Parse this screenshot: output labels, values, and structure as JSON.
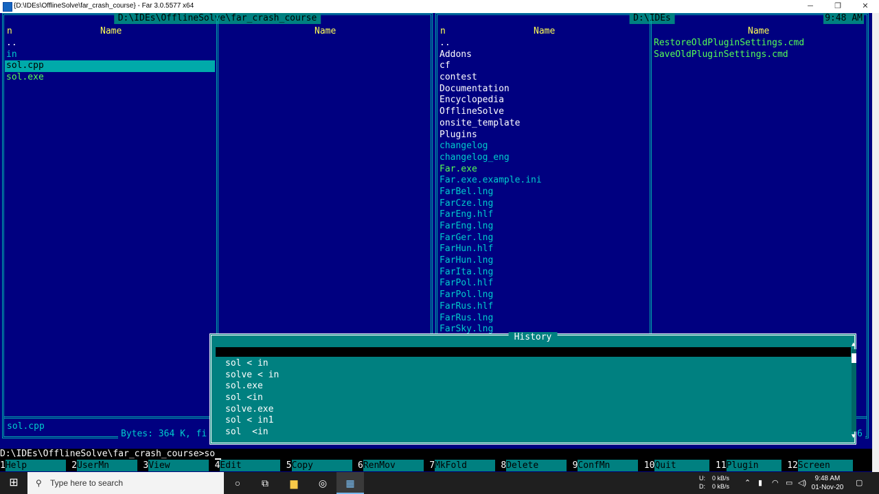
{
  "window": {
    "title": "{D:\\IDEs\\OfflineSolve\\far_crash_course} - Far 3.0.5577 x64",
    "min": "─",
    "restore": "❐",
    "close": "✕"
  },
  "left_panel": {
    "path": "D:\\IDEs\\OfflineSolve\\far_crash_course",
    "col1_header_n": "n",
    "col1_header": "Name",
    "col2_header": "Name",
    "items": [
      {
        "name": "..",
        "kind": "dir"
      },
      {
        "name": "in",
        "kind": "file"
      },
      {
        "name": "sol.cpp",
        "kind": "file",
        "selected": true
      },
      {
        "name": "sol.exe",
        "kind": "exe"
      }
    ],
    "status_name": "sol.cpp",
    "info": "Bytes: 364 K, fi"
  },
  "right_panel": {
    "path": "D:\\IDEs",
    "clock": "9:48 AM",
    "col1_header_n": "n",
    "col1_header": "Name",
    "col2_header": "Name",
    "items_col1": [
      {
        "name": "..",
        "kind": "dir"
      },
      {
        "name": "Addons",
        "kind": "dir"
      },
      {
        "name": "cf",
        "kind": "dir"
      },
      {
        "name": "contest",
        "kind": "dir"
      },
      {
        "name": "Documentation",
        "kind": "dir"
      },
      {
        "name": "Encyclopedia",
        "kind": "dir"
      },
      {
        "name": "OfflineSolve",
        "kind": "dir"
      },
      {
        "name": "onsite_template",
        "kind": "dir"
      },
      {
        "name": "Plugins",
        "kind": "dir"
      },
      {
        "name": "changelog",
        "kind": "file"
      },
      {
        "name": "changelog_eng",
        "kind": "file"
      },
      {
        "name": "Far.exe",
        "kind": "exe"
      },
      {
        "name": "Far.exe.example.ini",
        "kind": "file"
      },
      {
        "name": "FarBel.lng",
        "kind": "file"
      },
      {
        "name": "FarCze.lng",
        "kind": "file"
      },
      {
        "name": "FarEng.hlf",
        "kind": "file"
      },
      {
        "name": "FarEng.lng",
        "kind": "file"
      },
      {
        "name": "FarGer.lng",
        "kind": "file"
      },
      {
        "name": "FarHun.hlf",
        "kind": "file"
      },
      {
        "name": "FarHun.lng",
        "kind": "file"
      },
      {
        "name": "FarIta.lng",
        "kind": "file"
      },
      {
        "name": "FarPol.hlf",
        "kind": "file"
      },
      {
        "name": "FarPol.lng",
        "kind": "file"
      },
      {
        "name": "FarRus.hlf",
        "kind": "file"
      },
      {
        "name": "FarRus.lng",
        "kind": "file"
      },
      {
        "name": "FarSky.lng",
        "kind": "file"
      }
    ],
    "items_col2": [
      {
        "name": "RestoreOldPluginSettings.cmd",
        "kind": "cmd"
      },
      {
        "name": "SaveOldPluginSettings.cmd",
        "kind": "cmd"
      }
    ],
    "info_right": "6"
  },
  "history": {
    "title": "History",
    "items": [
      "sol < in",
      "solve < in",
      "sol.exe",
      "sol <in",
      "solve.exe",
      "sol < in1",
      "sol  <in"
    ],
    "scroll_up": "▲",
    "scroll_down": "▼"
  },
  "cmdline": {
    "prompt": "D:\\IDEs\\OfflineSolve\\far_crash_course>",
    "text": "so"
  },
  "keybar": [
    {
      "num": "1",
      "label": "Help"
    },
    {
      "num": "2",
      "label": "UserMn"
    },
    {
      "num": "3",
      "label": "View"
    },
    {
      "num": "4",
      "label": "Edit"
    },
    {
      "num": "5",
      "label": "Copy"
    },
    {
      "num": "6",
      "label": "RenMov"
    },
    {
      "num": "7",
      "label": "MkFold"
    },
    {
      "num": "8",
      "label": "Delete"
    },
    {
      "num": "9",
      "label": "ConfMn"
    },
    {
      "num": "10",
      "label": "Quit"
    },
    {
      "num": "11",
      "label": "Plugin"
    },
    {
      "num": "12",
      "label": "Screen"
    }
  ],
  "taskbar": {
    "search_placeholder": "Type here to search",
    "net_up_label": "U:",
    "net_up": "0 kB/s",
    "net_down_label": "D:",
    "net_down": "0 kB/s",
    "time": "9:48 AM",
    "date": "01-Nov-20"
  }
}
